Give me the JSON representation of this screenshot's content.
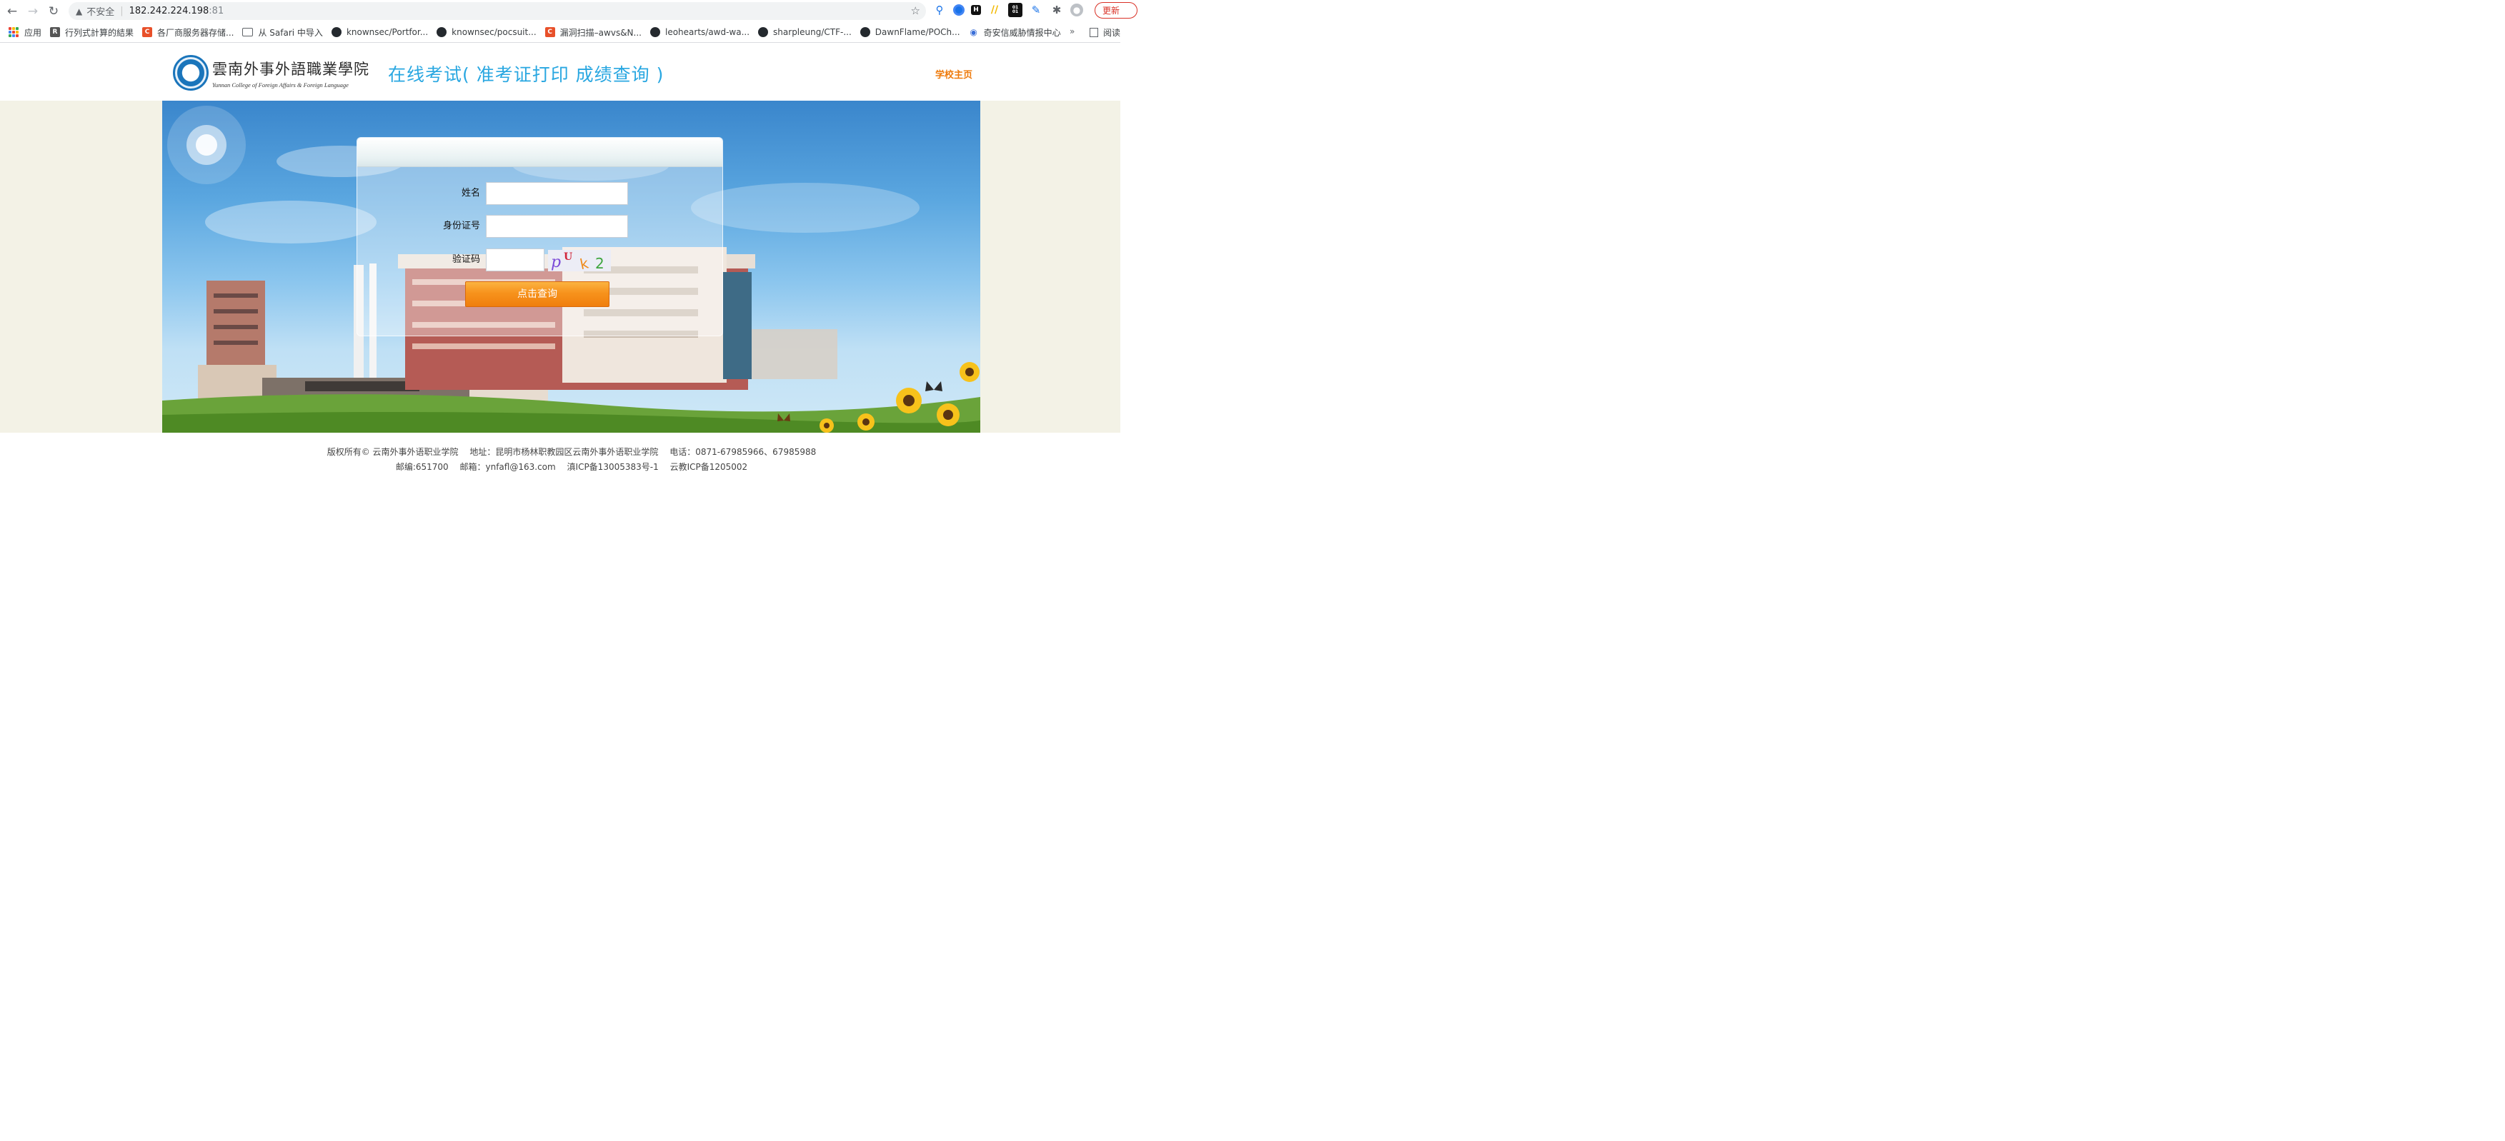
{
  "browser": {
    "insecure_label": "不安全",
    "url_host": "182.242.224.198",
    "url_port": ":81",
    "update_label": "更新",
    "extensions": [
      "location-icon",
      "chrome-circle-icon",
      "h-icon",
      "stripes-icon",
      "binary-icon",
      "note-icon",
      "puzzle-icon",
      "profile-icon"
    ]
  },
  "bookmarks": {
    "apps_label": "应用",
    "items": [
      {
        "label": "行列式計算的結果",
        "icon": "r-icon"
      },
      {
        "label": "各厂商服务器存储...",
        "icon": "c-icon"
      },
      {
        "label": "从 Safari 中导入",
        "icon": "folder-icon"
      },
      {
        "label": "knownsec/Portfor...",
        "icon": "github-icon"
      },
      {
        "label": "knownsec/pocsuit...",
        "icon": "github-icon"
      },
      {
        "label": "漏洞扫描–awvs&N...",
        "icon": "c-icon"
      },
      {
        "label": "leohearts/awd-wa...",
        "icon": "github-icon"
      },
      {
        "label": "sharpleung/CTF-...",
        "icon": "github-icon"
      },
      {
        "label": "DawnFlame/POCh...",
        "icon": "github-icon"
      },
      {
        "label": "奇安信威胁情报中心",
        "icon": "eye-icon"
      }
    ],
    "more_label": "»",
    "reading_label": "阅读"
  },
  "header": {
    "logo_cn": "雲南外事外語職業學院",
    "logo_en": "Yunnan College of Foreign Affairs & Foreign Language",
    "title": "在线考试( 准考证打印  成绩查询 )",
    "home_link": "学校主页"
  },
  "form": {
    "name_label": "姓名",
    "id_label": "身份证号",
    "captcha_label": "验证码",
    "name_value": "",
    "id_value": "",
    "captcha_value": "",
    "captcha_chars": [
      "p",
      "U",
      "k",
      "2"
    ],
    "submit_label": "点击查询"
  },
  "footer": {
    "copyright": "版权所有© 云南外事外语职业学院",
    "address": "地址：昆明市杨林职教园区云南外事外语职业学院",
    "phone": "电话：0871-67985966、67985988",
    "postcode": "邮编:651700",
    "email": "邮箱：ynfafl@163.com",
    "icp1": "滇ICP备13005383号-1",
    "icp2": "云教ICP备1205002"
  },
  "colors": {
    "title_blue": "#29a7e1",
    "home_orange": "#ee7a0b",
    "button_orange": "#f7921c"
  }
}
